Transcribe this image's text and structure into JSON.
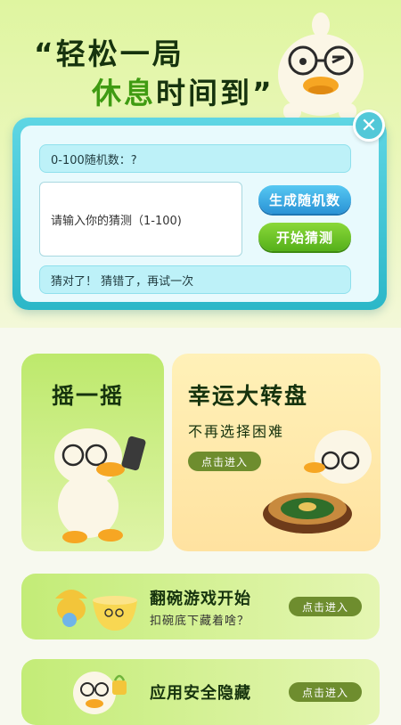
{
  "hero": {
    "title_line1": "“轻松一局",
    "title_line2_green": "休息",
    "title_line2_dark": "时间到”"
  },
  "guess_game": {
    "random_label": "0-100随机数：?",
    "input_placeholder": "请输入你的猜测（1-100)",
    "generate_button": "生成随机数",
    "start_button": "开始猜测",
    "result_text": "猜对了！ 猜错了，再试一次",
    "close_icon": "close-icon"
  },
  "tiles": {
    "shake": {
      "title": "摇一摇"
    },
    "wheel": {
      "title": "幸运大转盘",
      "subtitle": "不再选择困难",
      "enter": "点击进入"
    }
  },
  "rows": [
    {
      "title": "翻碗游戏开始",
      "subtitle": "扣碗底下藏着啥？",
      "enter": "点击进入"
    },
    {
      "title": "应用安全隐藏",
      "subtitle": "",
      "enter": "点击进入"
    }
  ],
  "colors": {
    "accent_green": "#3f9b12",
    "accent_cyan": "#2bb7c8",
    "accent_blue": "#2a93d6"
  }
}
